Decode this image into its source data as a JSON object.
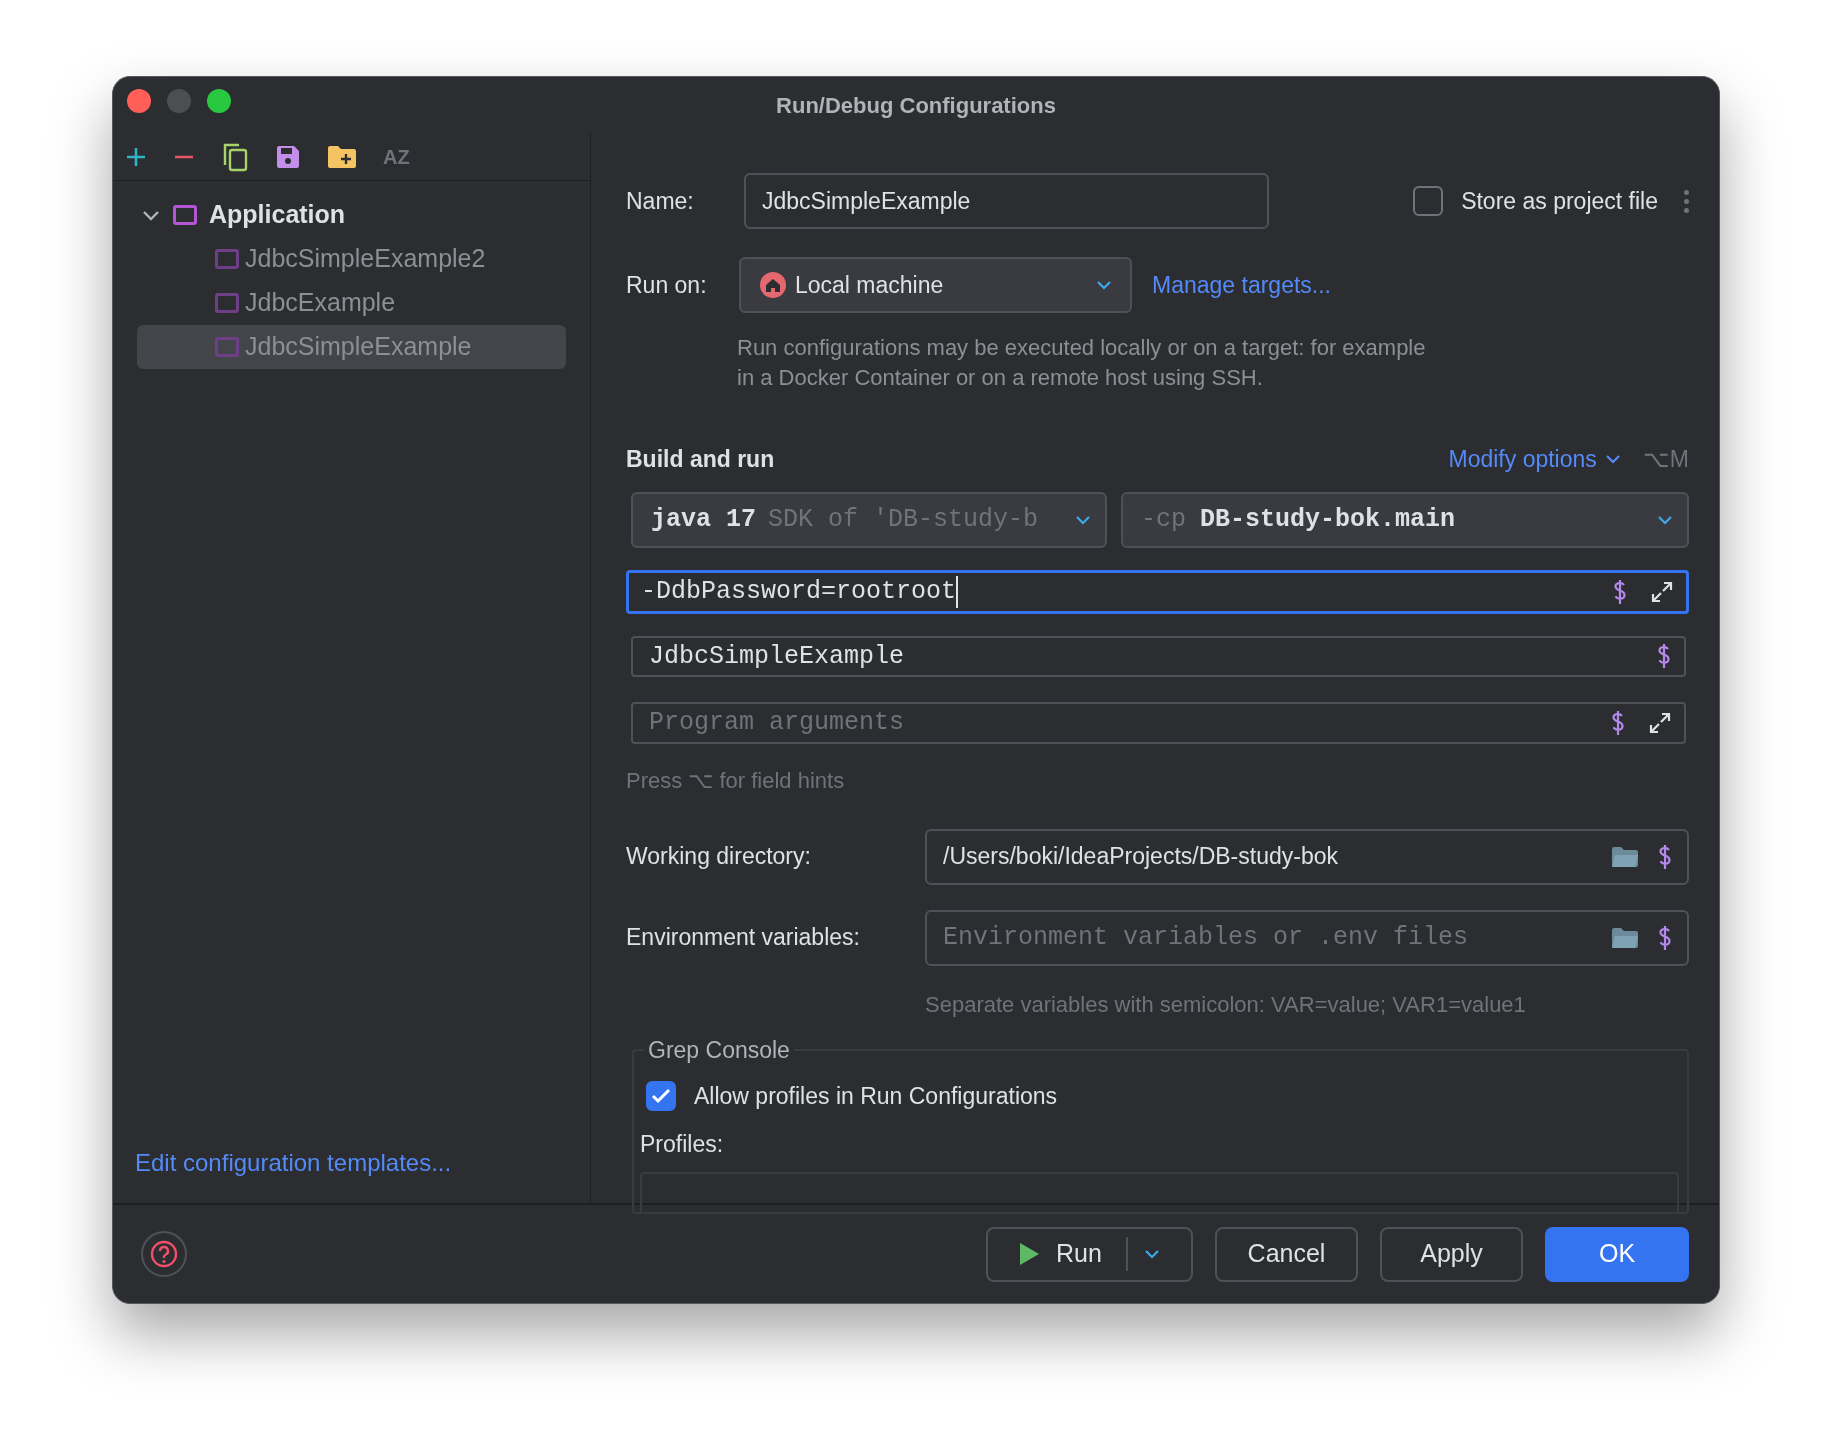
{
  "window": {
    "title": "Run/Debug Configurations"
  },
  "toolbar": [
    {
      "kind": "add"
    },
    {
      "kind": "remove"
    },
    {
      "kind": "copy"
    },
    {
      "kind": "save"
    },
    {
      "kind": "new-folder"
    },
    {
      "kind": "sort",
      "label": "AZ",
      "disabled": true
    }
  ],
  "sidebar": {
    "tree": [
      {
        "label": "Application",
        "expanded": true,
        "selected": false,
        "children": [
          {
            "label": "JdbcSimpleExample2",
            "selected": false
          },
          {
            "label": "JdbcExample",
            "selected": false
          },
          {
            "label": "JdbcSimpleExample",
            "selected": true
          }
        ]
      }
    ],
    "link": "Edit configuration templates..."
  },
  "form": {
    "name_label": "Name:",
    "name_value": "JdbcSimpleExample",
    "store": {
      "label": "Store as project file",
      "checked": false
    },
    "run_on_label": "Run on:",
    "run_on_value": "Local machine",
    "manage_link": "Manage targets...",
    "run_on_hint": "Run configurations may be executed locally or on a target: for example in a Docker Container or on a remote host using SSH.",
    "build": {
      "title": "Build and run",
      "modify": "Modify options",
      "shortcut": "⌥M",
      "sdk": {
        "main": "java 17",
        "detail": "SDK of 'DB-study-b"
      },
      "classpath": {
        "prefix": "-cp",
        "value": "DB-study-bok.main"
      },
      "vm_options": {
        "value": "-DdbPassword=rootroot",
        "focused": true
      },
      "main_class": {
        "value": "JdbcSimpleExample",
        "focused": false
      },
      "program_args": {
        "placeholder": "Program arguments"
      },
      "hint": "Press ⌥ for field hints"
    },
    "working_dir": {
      "label": "Working directory:",
      "value": "/Users/boki/IdeaProjects/DB-study-bok"
    },
    "env": {
      "label": "Environment variables:",
      "placeholder": "Environment variables or .env files"
    },
    "env_hint": "Separate variables with semicolon: VAR=value; VAR1=value1",
    "grep": {
      "title": "Grep Console",
      "allow": {
        "label": "Allow profiles in Run Configurations",
        "checked": true
      },
      "profiles_label": "Profiles:"
    }
  },
  "footer": {
    "buttons": [
      {
        "kind": "split",
        "label": "Run"
      },
      {
        "kind": "normal",
        "label": "Cancel"
      },
      {
        "kind": "normal",
        "label": "Apply"
      },
      {
        "kind": "primary",
        "label": "OK"
      }
    ]
  }
}
